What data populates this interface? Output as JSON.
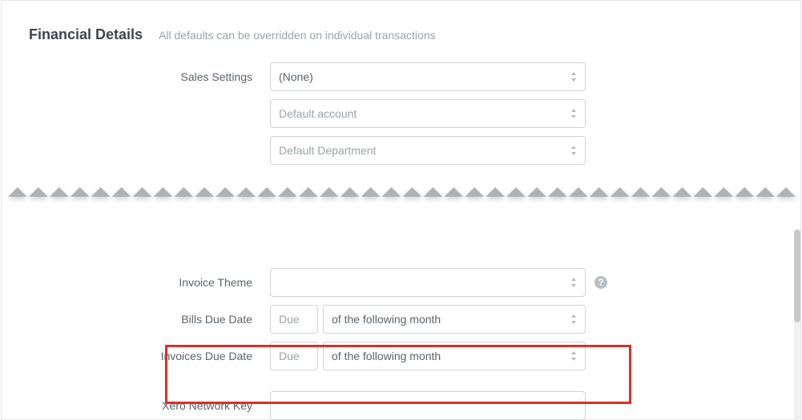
{
  "header": {
    "title": "Financial Details",
    "subtitle": "All defaults can be overridden on individual transactions"
  },
  "labels": {
    "sales_settings": "Sales Settings",
    "invoice_theme": "Invoice Theme",
    "bills_due_date": "Bills Due Date",
    "invoices_due_date": "Invoices Due Date",
    "xero_network_key": "Xero Network Key"
  },
  "fields": {
    "sales_settings_value": "(None)",
    "default_account_placeholder": "Default account",
    "default_department_placeholder": "Default Department",
    "invoice_theme_value": "",
    "bills_due_placeholder": "Due",
    "bills_period_value": "of the following month",
    "invoices_due_placeholder": "Due",
    "invoices_period_value": "of the following month",
    "xero_network_key_value": ""
  }
}
